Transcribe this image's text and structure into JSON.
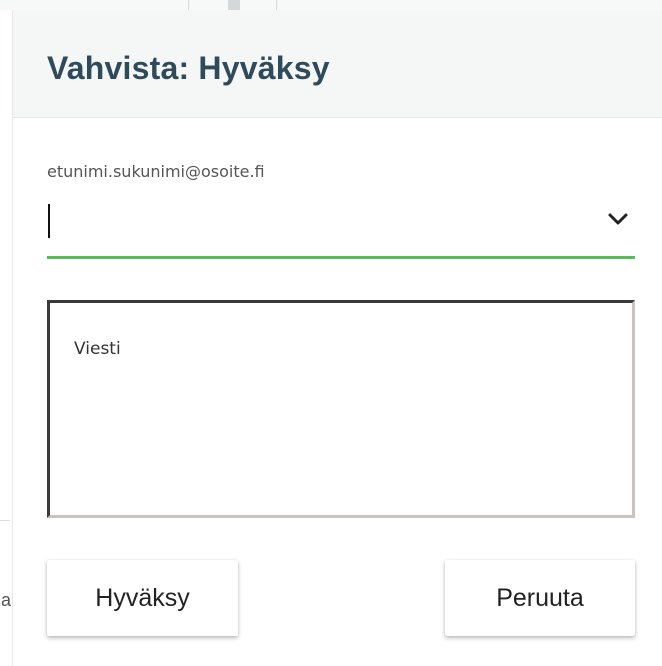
{
  "dialog": {
    "title": "Vahvista: Hyväksy",
    "recipient": {
      "placeholder": "etunimi.sukunimi@osoite.fi",
      "value": ""
    },
    "message": {
      "placeholder": "Viesti",
      "value": ""
    },
    "buttons": {
      "approve_label": "Hyväksy",
      "cancel_label": "Peruuta"
    }
  },
  "colors": {
    "title": "#2f4a5a",
    "header_bg": "#f5f7f7",
    "focus_underline": "#5cb85c"
  },
  "icons": {
    "dropdown": "chevron-down-icon"
  }
}
